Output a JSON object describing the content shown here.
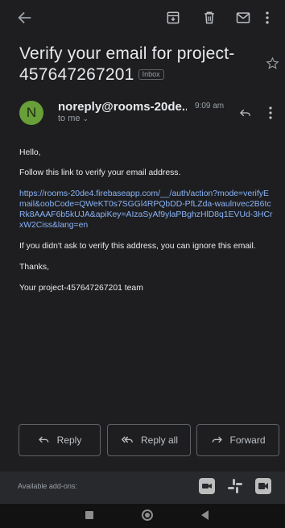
{
  "subject": {
    "text": "Verify your email for project-457647267201",
    "label": "Inbox"
  },
  "message": {
    "avatar_letter": "N",
    "sender": "noreply@rooms-20de...",
    "time": "9:09 am",
    "recipient": "to me"
  },
  "body": {
    "greeting": "Hello,",
    "instruction": "Follow this link to verify your email address.",
    "link": "https://rooms-20de4.firebaseapp.com/__/auth/action?mode=verifyEmail&oobCode=QWeKT0s7SGGl4RPQbDD-PfLZda-waulnvec2B6tcRk8AAAF6b5kUJA&apiKey=AIzaSyAf9ylaPBghzHlD8q1EVUd-3HCrxW2Ciss&lang=en",
    "ignore_note": "If you didn't ask to verify this address, you can ignore this email.",
    "thanks": "Thanks,",
    "signature": "Your project-457647267201 team"
  },
  "actions": {
    "reply": "Reply",
    "reply_all": "Reply all",
    "forward": "Forward"
  },
  "addons": {
    "label": "Available add-ons:",
    "items": [
      "zoom-icon",
      "slack-icon",
      "meet-icon"
    ]
  },
  "colors": {
    "background": "#1e1e20",
    "link": "#8ab4f8",
    "avatar": "#689f38",
    "muted": "#9aa0a6"
  }
}
